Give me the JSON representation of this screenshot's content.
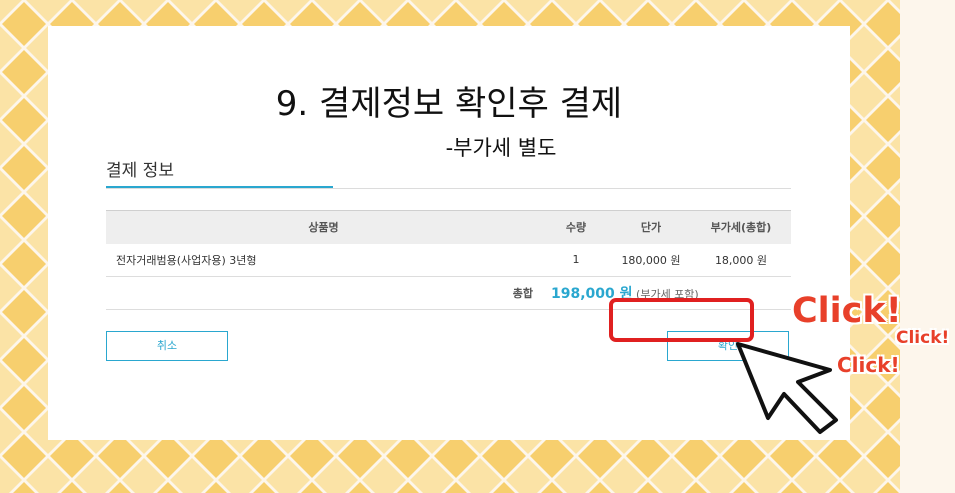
{
  "page": {
    "heading": "9. 결제정보 확인후 결제",
    "subheading": "-부가세 별도"
  },
  "section": {
    "title": "결제 정보"
  },
  "table": {
    "headers": {
      "product": "상품명",
      "quantity": "수량",
      "unit_price": "단가",
      "vat": "부가세(총합)"
    },
    "rows": [
      {
        "product": "전자거래범용(사업자용) 3년형",
        "quantity": "1",
        "unit_price": "180,000 원",
        "vat": "18,000 원"
      }
    ],
    "total": {
      "label": "총합",
      "amount": "198,000 원",
      "note": "(부가세 포함)"
    }
  },
  "buttons": {
    "cancel": "취소",
    "confirm": "확인"
  },
  "annotation": {
    "click_1": "Click!",
    "click_2": "Click!",
    "click_3": "Click!"
  },
  "colors": {
    "accent": "#2aa7cf",
    "highlight": "#e02020",
    "click_text": "#e8402a",
    "pattern": "#f7cf6e"
  },
  "icons": {
    "pointer": "mouse-pointer-icon"
  }
}
